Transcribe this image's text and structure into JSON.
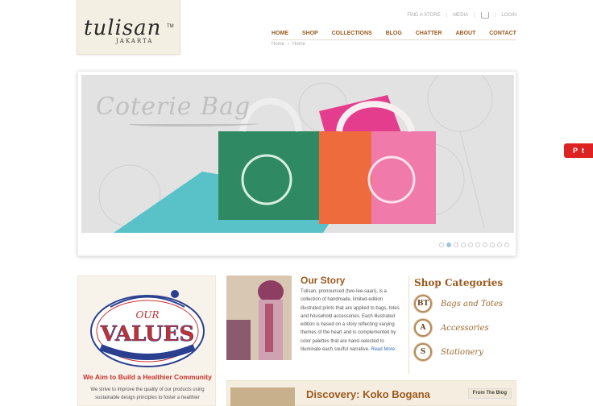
{
  "header": {
    "brand": "tulisan",
    "brand_sub": "JAKARTA",
    "brand_tm": "TM",
    "utility_links": [
      "FIND A STORE",
      "MEDIA",
      "LOGIN"
    ],
    "nav": [
      "HOME",
      "SHOP",
      "COLLECTIONS",
      "BLOG",
      "CHATTER",
      "ABOUT",
      "CONTACT"
    ],
    "breadcrumb": [
      "Home",
      "Home"
    ]
  },
  "hero": {
    "title": "Coterie Bag",
    "slide_count": 10,
    "active_slide": 1
  },
  "social": {
    "icons": [
      "pinterest-icon",
      "twitter-icon"
    ],
    "labels": [
      "P",
      "t"
    ]
  },
  "values": {
    "badge_top": "OUR",
    "badge_main": "VALUES",
    "heading": "We Aim to Build a Healthier Community",
    "body": "We strive to improve the quality of our products using sustainable design principles to foster a healthier"
  },
  "story": {
    "title": "Our Story",
    "body": "Tulisan, pronounced (two-lee-saan), is a collection of handmade, limited-edition illustrated prints that are applied to bags, totes and household accessories. Each illustrated edition is based on a story reflecting varying themes of the heart and is complemented by color palettes that are hand-selected to illuminate each soulful narrative.",
    "more": "Read More"
  },
  "shop": {
    "title": "Shop Categories",
    "categories": [
      {
        "badge": "BT",
        "label": "Bags and Totes"
      },
      {
        "badge": "A",
        "label": "Accessories"
      },
      {
        "badge": "S",
        "label": "Stationery"
      }
    ]
  },
  "discovery": {
    "title": "Discovery: Koko Bogana",
    "tab": "From The Blog"
  },
  "colors": {
    "accent": "#9b5a1e",
    "red": "#c9302c",
    "link": "#2a6fb8"
  }
}
